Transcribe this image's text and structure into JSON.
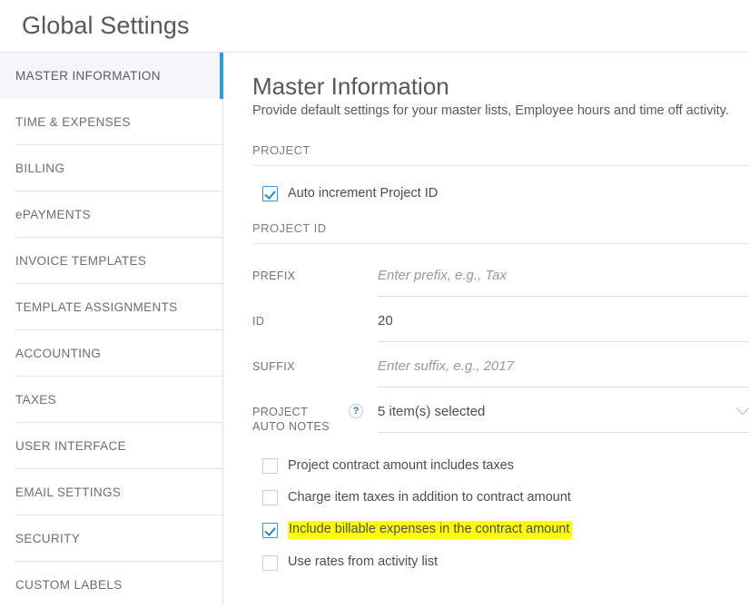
{
  "header": {
    "title": "Global Settings"
  },
  "sidebar": {
    "items": [
      {
        "label": "MASTER INFORMATION",
        "active": true
      },
      {
        "label": "TIME & EXPENSES",
        "active": false
      },
      {
        "label": "BILLING",
        "active": false
      },
      {
        "label": "ePAYMENTS",
        "active": false
      },
      {
        "label": "INVOICE TEMPLATES",
        "active": false
      },
      {
        "label": "TEMPLATE ASSIGNMENTS",
        "active": false
      },
      {
        "label": "ACCOUNTING",
        "active": false
      },
      {
        "label": "TAXES",
        "active": false
      },
      {
        "label": "USER INTERFACE",
        "active": false
      },
      {
        "label": "EMAIL SETTINGS",
        "active": false
      },
      {
        "label": "SECURITY",
        "active": false
      },
      {
        "label": "CUSTOM LABELS",
        "active": false
      }
    ]
  },
  "main": {
    "title": "Master Information",
    "subtitle": "Provide default settings for your master lists, Employee hours and time off activity.",
    "project_section": {
      "heading": "PROJECT",
      "auto_increment": {
        "label": "Auto increment Project ID",
        "checked": true
      }
    },
    "project_id_section": {
      "heading": "PROJECT ID",
      "fields": [
        {
          "label": "PREFIX",
          "value": "",
          "placeholder": "Enter prefix, e.g., Tax",
          "help": false,
          "chevron": false
        },
        {
          "label": "ID",
          "value": "20",
          "placeholder": "",
          "help": false,
          "chevron": false
        },
        {
          "label": "SUFFIX",
          "value": "",
          "placeholder": "Enter suffix, e.g., 2017",
          "help": false,
          "chevron": false
        },
        {
          "label": "PROJECT AUTO NOTES",
          "value": "5 item(s) selected",
          "placeholder": "",
          "help": true,
          "help_icon": "question-mark-icon",
          "help_glyph": "?",
          "chevron": true
        }
      ]
    },
    "options": [
      {
        "label": "Project contract amount includes taxes",
        "checked": false,
        "highlighted": false
      },
      {
        "label": "Charge item taxes in addition to contract amount",
        "checked": false,
        "highlighted": false
      },
      {
        "label": "Include billable expenses in the contract amount",
        "checked": true,
        "highlighted": true
      },
      {
        "label": "Use rates from activity list",
        "checked": false,
        "highlighted": false
      }
    ]
  },
  "colors": {
    "accent": "#2d9cdb",
    "highlight": "#ffff00",
    "text": "#4d4d4f",
    "muted": "#7b7d80",
    "divider": "#e2e4e6",
    "active_bg": "#f4f6f7"
  }
}
